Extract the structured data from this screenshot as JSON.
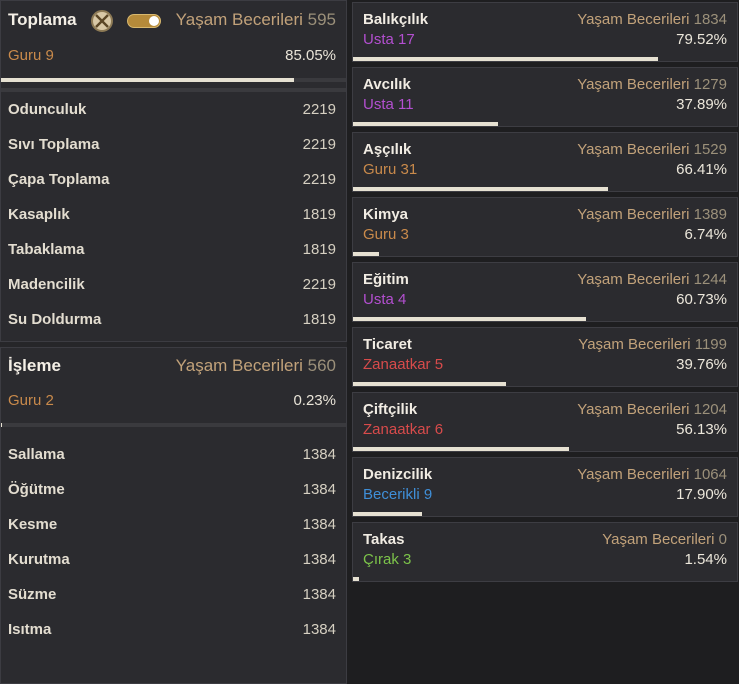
{
  "gathering": {
    "title": "Toplama",
    "ls_label": "Yaşam Becerileri",
    "ls_value": "595",
    "rank_name": "Guru",
    "rank_level": "9",
    "percent": "85.05%",
    "progress": 0.8505,
    "icon": "crossed-tools-icon",
    "toggle_state": "on",
    "items": [
      {
        "label": "Odunculuk",
        "value": "2219"
      },
      {
        "label": "Sıvı Toplama",
        "value": "2219"
      },
      {
        "label": "Çapa Toplama",
        "value": "2219"
      },
      {
        "label": "Kasaplık",
        "value": "1819"
      },
      {
        "label": "Tabaklama",
        "value": "1819"
      },
      {
        "label": "Madencilik",
        "value": "2219"
      },
      {
        "label": "Su Doldurma",
        "value": "1819"
      }
    ]
  },
  "processing": {
    "title": "İşleme",
    "ls_label": "Yaşam Becerileri",
    "ls_value": "560",
    "rank_name": "Guru",
    "rank_level": "2",
    "percent": "0.23%",
    "progress": 0.0023,
    "items": [
      {
        "label": "Sallama",
        "value": "1384"
      },
      {
        "label": "Öğütme",
        "value": "1384"
      },
      {
        "label": "Kesme",
        "value": "1384"
      },
      {
        "label": "Kurutma",
        "value": "1384"
      },
      {
        "label": "Süzme",
        "value": "1384"
      },
      {
        "label": "Isıtma",
        "value": "1384"
      }
    ]
  },
  "skills": [
    {
      "name": "Balıkçılık",
      "ls_label": "Yaşam Becerileri",
      "ls_value": "1834",
      "rank_name": "Usta",
      "rank_level": "17",
      "rank_color": "#b34fd0",
      "percent": "79.52%",
      "progress": 0.7952
    },
    {
      "name": "Avcılık",
      "ls_label": "Yaşam Becerileri",
      "ls_value": "1279",
      "rank_name": "Usta",
      "rank_level": "11",
      "rank_color": "#b34fd0",
      "percent": "37.89%",
      "progress": 0.3789
    },
    {
      "name": "Aşçılık",
      "ls_label": "Yaşam Becerileri",
      "ls_value": "1529",
      "rank_name": "Guru",
      "rank_level": "31",
      "rank_color": "#c98a4b",
      "percent": "66.41%",
      "progress": 0.6641
    },
    {
      "name": "Kimya",
      "ls_label": "Yaşam Becerileri",
      "ls_value": "1389",
      "rank_name": "Guru",
      "rank_level": "3",
      "rank_color": "#c98a4b",
      "percent": "6.74%",
      "progress": 0.0674
    },
    {
      "name": "Eğitim",
      "ls_label": "Yaşam Becerileri",
      "ls_value": "1244",
      "rank_name": "Usta",
      "rank_level": "4",
      "rank_color": "#b34fd0",
      "percent": "60.73%",
      "progress": 0.6073
    },
    {
      "name": "Ticaret",
      "ls_label": "Yaşam Becerileri",
      "ls_value": "1199",
      "rank_name": "Zanaatkar",
      "rank_level": "5",
      "rank_color": "#d84b4b",
      "percent": "39.76%",
      "progress": 0.3976
    },
    {
      "name": "Çiftçilik",
      "ls_label": "Yaşam Becerileri",
      "ls_value": "1204",
      "rank_name": "Zanaatkar",
      "rank_level": "6",
      "rank_color": "#d84b4b",
      "percent": "56.13%",
      "progress": 0.5613
    },
    {
      "name": "Denizcilik",
      "ls_label": "Yaşam Becerileri",
      "ls_value": "1064",
      "rank_name": "Becerikli",
      "rank_level": "9",
      "rank_color": "#3f8fd8",
      "percent": "17.90%",
      "progress": 0.179
    },
    {
      "name": "Takas",
      "ls_label": "Yaşam Becerileri",
      "ls_value": "0",
      "rank_name": "Çırak",
      "rank_level": "3",
      "rank_color": "#7cc34a",
      "percent": "1.54%",
      "progress": 0.0154
    }
  ]
}
